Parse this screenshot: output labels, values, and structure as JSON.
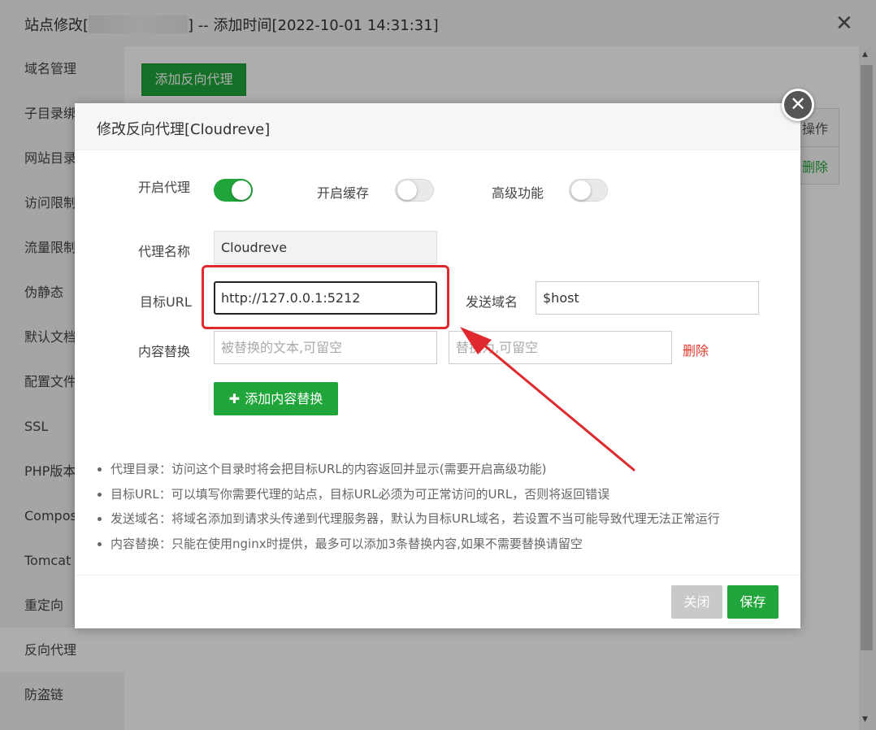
{
  "window": {
    "title_prefix": "站点修改[",
    "title_suffix": "] -- 添加时间[2022-10-01 14:31:31]",
    "close_glyph": "✕"
  },
  "sidebar": {
    "items": [
      {
        "label": "域名管理"
      },
      {
        "label": "子目录绑"
      },
      {
        "label": "网站目录"
      },
      {
        "label": "访问限制"
      },
      {
        "label": "流量限制"
      },
      {
        "label": "伪静态"
      },
      {
        "label": "默认文档"
      },
      {
        "label": "配置文件"
      },
      {
        "label": "SSL"
      },
      {
        "label": "PHP版本"
      },
      {
        "label": "Compos"
      },
      {
        "label": "Tomcat"
      },
      {
        "label": "重定向"
      },
      {
        "label": "反向代理"
      },
      {
        "label": "防盗链"
      }
    ],
    "active_index": 13
  },
  "main": {
    "add_proxy_button": "添加反向代理",
    "table_header_op": "操作",
    "table_row_delete": "删除"
  },
  "modal": {
    "title": "修改反向代理[Cloudreve]",
    "toggles": {
      "enable_proxy": {
        "label": "开启代理",
        "on": true
      },
      "enable_cache": {
        "label": "开启缓存",
        "on": false
      },
      "advanced": {
        "label": "高级功能",
        "on": false
      }
    },
    "proxy_name": {
      "label": "代理名称",
      "value": "Cloudreve"
    },
    "target_url": {
      "label": "目标URL",
      "value": "http://127.0.0.1:5212"
    },
    "send_domain": {
      "label": "发送域名",
      "value": "$host"
    },
    "content_replace": {
      "label": "内容替换",
      "from_placeholder": "被替换的文本,可留空",
      "to_placeholder": "替换为,可留空",
      "delete_label": "删除"
    },
    "add_replace_button": "添加内容替换",
    "tips": [
      "代理目录：访问这个目录时将会把目标URL的内容返回并显示(需要开启高级功能)",
      "目标URL：可以填写你需要代理的站点，目标URL必须为可正常访问的URL，否则将返回错误",
      "发送域名：将域名添加到请求头传递到代理服务器，默认为目标URL域名，若设置不当可能导致代理无法正常运行",
      "内容替换：只能在使用nginx时提供，最多可以添加3条替换内容,如果不需要替换请留空"
    ],
    "close_button": "关闭",
    "save_button": "保存",
    "close_x_glyph": "✕"
  },
  "colors": {
    "accent": "#20a53a",
    "danger": "#e0392b",
    "annotation": "#e0292f"
  }
}
